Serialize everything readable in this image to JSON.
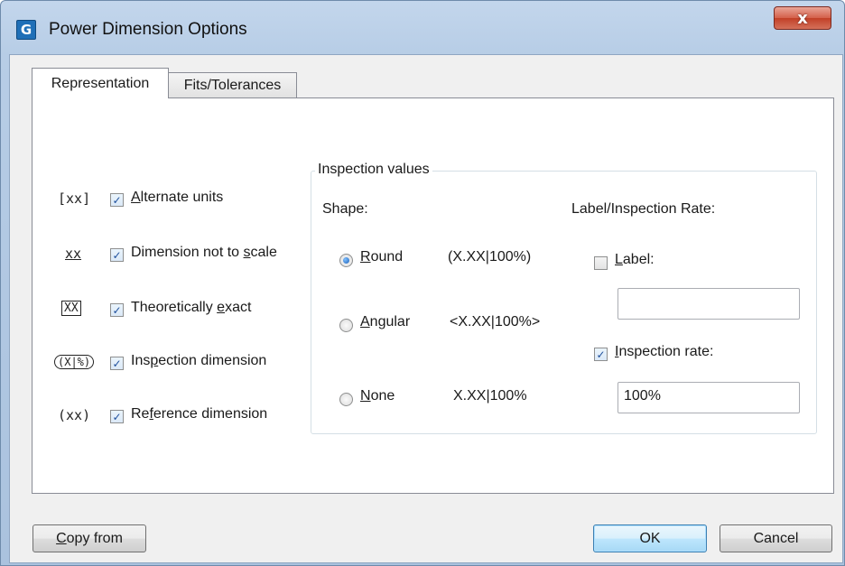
{
  "window": {
    "title": "Power Dimension Options",
    "close_glyph": "x",
    "app_icon": "power-dimension-app-icon"
  },
  "tabs": [
    {
      "label": "Representation",
      "active": true
    },
    {
      "label": "Fits/Tolerances",
      "active": false
    }
  ],
  "options": [
    {
      "symbol": "[xx]",
      "label_pre": "",
      "label_mn": "A",
      "label_post": "lternate units",
      "checked": true
    },
    {
      "symbol": "xx",
      "label_pre": "Dimension not to ",
      "label_mn": "s",
      "label_post": "cale",
      "checked": true
    },
    {
      "symbol": "XX",
      "label_pre": "Theoretically ",
      "label_mn": "e",
      "label_post": "xact",
      "checked": true
    },
    {
      "symbol": "(X|%)",
      "label_pre": "Ins",
      "label_mn": "p",
      "label_post": "ection dimension",
      "checked": true
    },
    {
      "symbol": "(xx)",
      "label_pre": "Re",
      "label_mn": "f",
      "label_post": "erence dimension",
      "checked": true
    }
  ],
  "inspection": {
    "group_title": "Inspection values",
    "shape_label": "Shape:",
    "rate_label": "Label/Inspection Rate:",
    "shapes": [
      {
        "label_mn": "R",
        "label_post": "ound",
        "preview": "(X.XX|100%)",
        "selected": true
      },
      {
        "label_mn": "A",
        "label_post": "ngular",
        "preview": "<X.XX|100%>",
        "selected": false
      },
      {
        "label_mn": "N",
        "label_post": "one",
        "preview": "X.XX|100%",
        "selected": false
      }
    ],
    "label_checkbox": {
      "label_mn": "L",
      "label_post": "abel:",
      "checked": false,
      "value": ""
    },
    "rate_checkbox": {
      "label_mn": "I",
      "label_post": "nspection rate:",
      "checked": true,
      "value": "100%"
    }
  },
  "buttons": {
    "copy_from_mn": "C",
    "copy_from_post": "opy from",
    "ok": "OK",
    "cancel": "Cancel"
  },
  "colors": {
    "titlebar": "#b7cde6",
    "close": "#c24027",
    "checkmark": "#1e4f9c",
    "radio_dot": "#1c5fb7"
  }
}
